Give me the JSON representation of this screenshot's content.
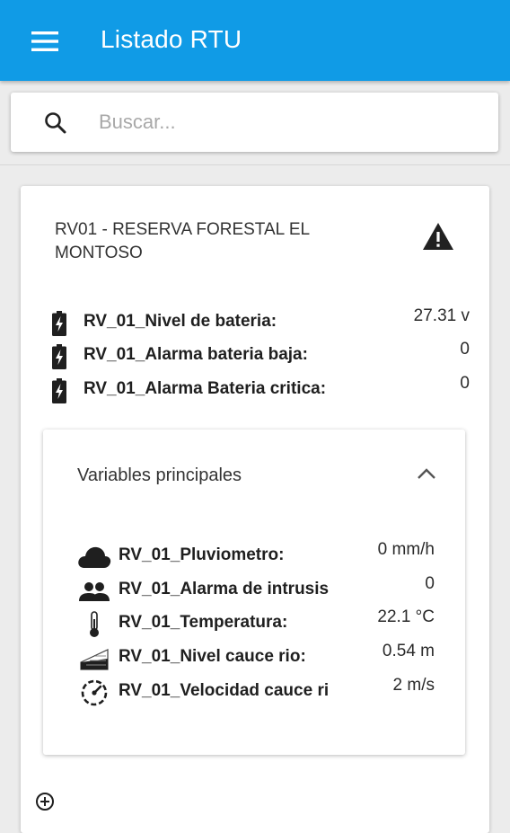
{
  "appbar": {
    "title": "Listado RTU",
    "menu_icon": "menu-icon",
    "background": "#109be6"
  },
  "search": {
    "placeholder": "Buscar...",
    "value": "",
    "icon": "search-icon"
  },
  "rtu": {
    "title": "RV01 - RESERVA FORESTAL EL MONTOSO",
    "status_icon": "warning-icon",
    "battery_rows": [
      {
        "icon": "battery-charging-icon",
        "label": "RV_01_Nivel de bateria:",
        "value": "27.31 v"
      },
      {
        "icon": "battery-charging-icon",
        "label": "RV_01_Alarma bateria baja:",
        "value": "0"
      },
      {
        "icon": "battery-charging-icon",
        "label": "RV_01_Alarma Bateria critica:",
        "value": "0"
      }
    ],
    "panel": {
      "title": "Variables principales",
      "toggle_icon": "chevron-up-icon",
      "rows": [
        {
          "icon": "cloud-icon",
          "label": "RV_01_Pluviometro:",
          "value": "0 mm/h"
        },
        {
          "icon": "people-icon",
          "label": "RV_01_Alarma de intrusis",
          "value": "0"
        },
        {
          "icon": "thermometer-icon",
          "label": "RV_01_Temperatura:",
          "value": "22.1 °C"
        },
        {
          "icon": "water-level-icon",
          "label": "RV_01_Nivel cauce rio:",
          "value": "0.54 m"
        },
        {
          "icon": "speedometer-icon",
          "label": "RV_01_Velocidad cauce ri",
          "value": "2 m/s"
        }
      ]
    },
    "add_icon": "add-circle-icon"
  }
}
